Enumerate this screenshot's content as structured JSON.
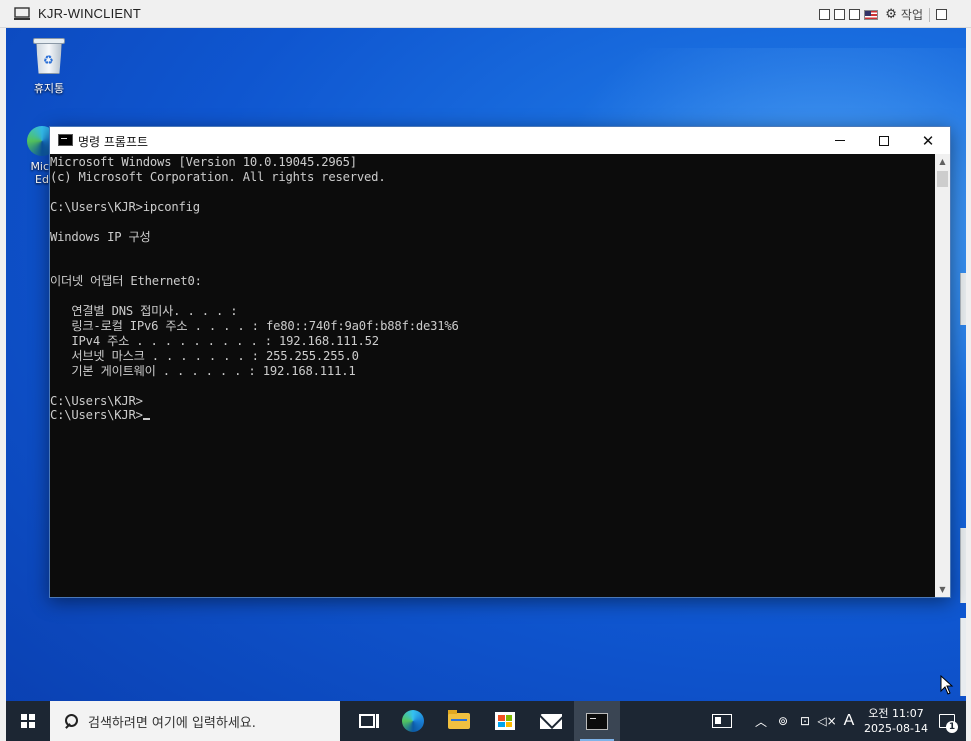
{
  "vm_window": {
    "title": "KJR-WINCLIENT",
    "task_label": "작업"
  },
  "desktop": {
    "icons": [
      {
        "label": "휴지통"
      },
      {
        "label": "Micr Ed"
      }
    ]
  },
  "cmd_window": {
    "title": "명령 프롬프트",
    "lines": [
      "Microsoft Windows [Version 10.0.19045.2965]",
      "(c) Microsoft Corporation. All rights reserved.",
      "",
      "C:\\Users\\KJR>ipconfig",
      "",
      "Windows IP 구성",
      "",
      "",
      "이더넷 어댑터 Ethernet0:",
      "",
      "   연결별 DNS 접미사. . . . :",
      "   링크-로컬 IPv6 주소 . . . . : fe80::740f:9a0f:b88f:de31%6",
      "   IPv4 주소 . . . . . . . . . : 192.168.111.52",
      "   서브넷 마스크 . . . . . . . : 255.255.255.0",
      "   기본 게이트웨이 . . . . . . : 192.168.111.1",
      "",
      "C:\\Users\\KJR>",
      "C:\\Users\\KJR>"
    ]
  },
  "taskbar": {
    "search_placeholder": "검색하려면 여기에 입력하세요.",
    "ime_label": "A",
    "clock_time": "오전 11:07",
    "clock_date": "2025-08-14",
    "notification_count": "1",
    "apps": [
      "task-view",
      "edge",
      "file-explorer",
      "store",
      "mail",
      "command-prompt"
    ]
  },
  "colors": {
    "console_bg": "#0c0c0c",
    "console_fg": "#cccccc",
    "taskbar_bg": "#1c2633",
    "desktop_blue": "#0f56d0"
  }
}
